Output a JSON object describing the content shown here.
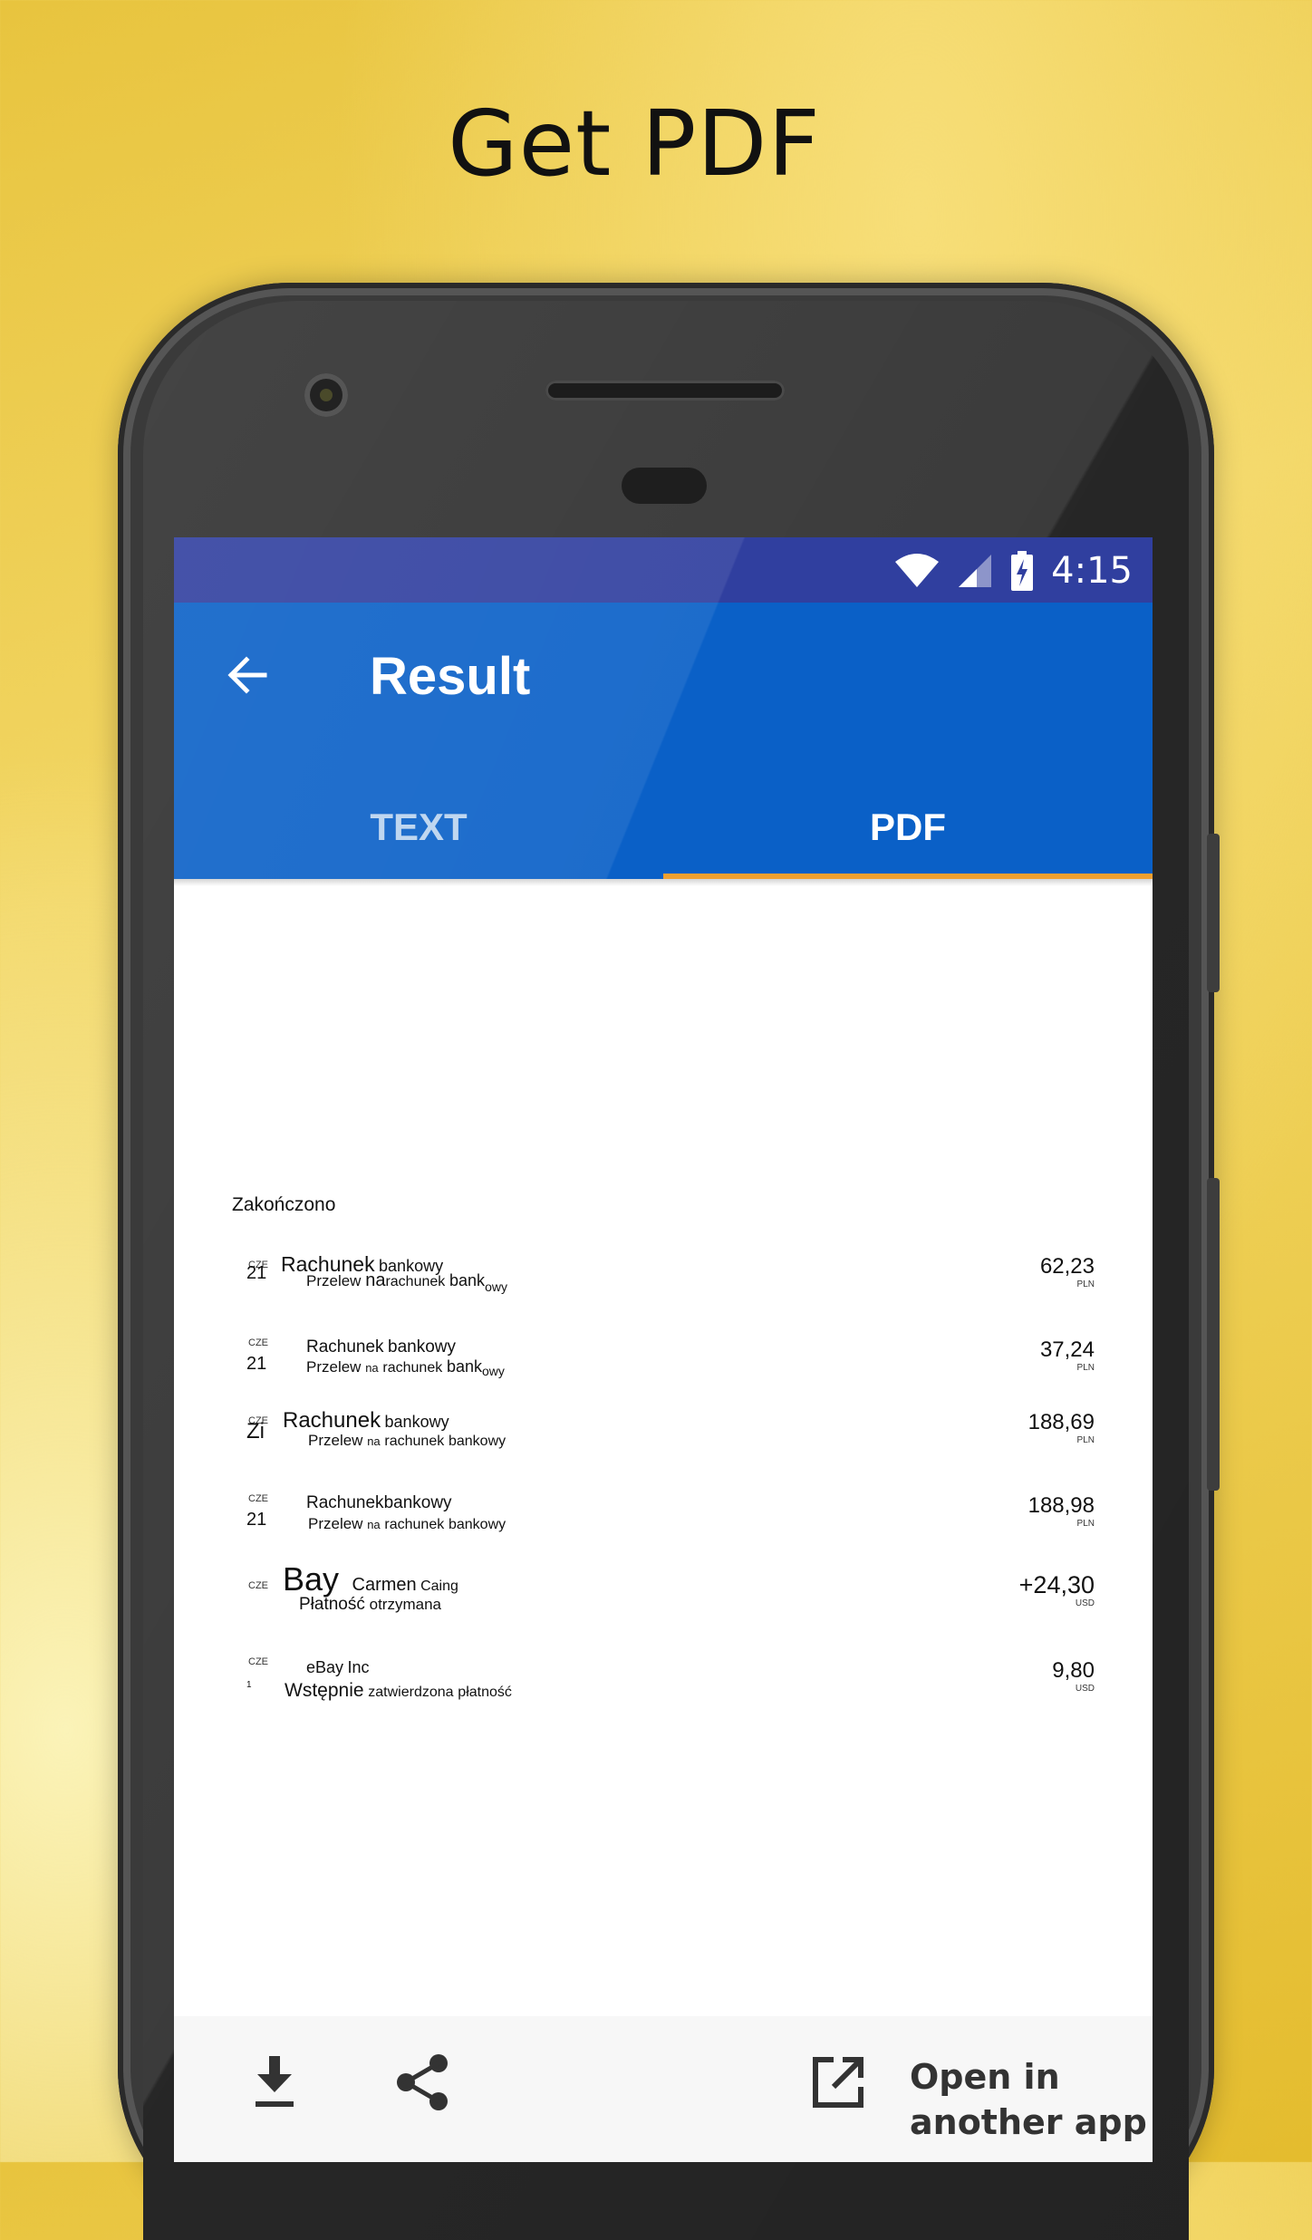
{
  "headline": "Get PDF",
  "status_bar": {
    "time": "4:15"
  },
  "app_bar": {
    "title": "Result",
    "tabs": [
      {
        "label": "TEXT",
        "selected": false
      },
      {
        "label": "PDF",
        "selected": true
      }
    ]
  },
  "pdf": {
    "status_label": "Zakończono",
    "transactions": [
      {
        "month": "CZE",
        "day": "21",
        "title": [
          "Rachunek",
          "bankowy"
        ],
        "subtitle": [
          "Przelew",
          "na",
          "rachunek",
          "bank",
          "owy"
        ],
        "amount": "62,23",
        "currency": "PLN"
      },
      {
        "month": "CZE",
        "day": "21",
        "title": [
          "Rachunek",
          "bankowy"
        ],
        "subtitle": [
          "Przelew",
          "na",
          "rachunek",
          "bank",
          "owy"
        ],
        "amount": "37,24",
        "currency": "PLN"
      },
      {
        "month": "CZE",
        "day": "Zi",
        "title": [
          "Rachunek",
          "bankowy"
        ],
        "subtitle": [
          "Przelew",
          "na",
          "rachunek",
          "bankowy"
        ],
        "amount": "188,69",
        "currency": "PLN"
      },
      {
        "month": "CZE",
        "day": "21",
        "title": [
          "Rachunek",
          "bankowy"
        ],
        "subtitle": [
          "Przelew",
          "na",
          "rachunek",
          "bankowy"
        ],
        "amount": "188,98",
        "currency": "PLN"
      },
      {
        "month": "CZE",
        "day": "",
        "title": [
          "Bay",
          "Carmen",
          "Caing"
        ],
        "subtitle": [
          "Płatność",
          "otrzymana"
        ],
        "amount": "+24,30",
        "currency": "USD"
      },
      {
        "month": "CZE",
        "day": "1",
        "title": [
          "eBay",
          "Inc"
        ],
        "subtitle": [
          "Wstępnie",
          "zatwierdzona",
          "płatność"
        ],
        "amount": "9,80",
        "currency": "USD"
      }
    ]
  },
  "bottom_bar": {
    "download_icon": "download-icon",
    "share_icon": "share-icon",
    "open_icon": "open-in-new-icon",
    "open_label_line1": "Open in",
    "open_label_line2": "another app"
  },
  "colors": {
    "status_bar": "#303f9f",
    "app_bar": "#0a60c7",
    "tab_indicator": "#f0a030",
    "background": "#f2d664"
  }
}
